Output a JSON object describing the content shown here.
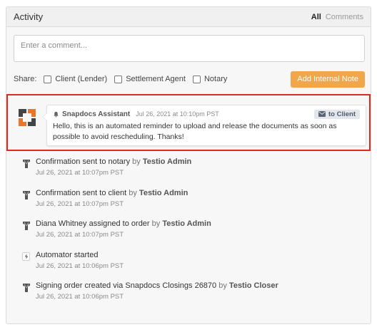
{
  "panel": {
    "title": "Activity",
    "filters": {
      "all": "All",
      "comments": "Comments"
    }
  },
  "comment": {
    "placeholder": "Enter a comment..."
  },
  "share": {
    "label": "Share:",
    "options": [
      "Client (Lender)",
      "Settlement Agent",
      "Notary"
    ],
    "add_note_label": "Add Internal Note"
  },
  "highlighted_message": {
    "author": "Snapdocs Assistant",
    "timestamp": "Jul 26, 2021 at 10:10pm PST",
    "badge": "to Client",
    "text": "Hello, this is an automated reminder to upload and release the documents as soon as possible to avoid rescheduling. Thanks!"
  },
  "feed": [
    {
      "text": "Confirmation sent to notary",
      "by": "by",
      "actor": "Testio Admin",
      "time": "Jul 26, 2021 at 10:07pm PST",
      "icon": "user-icon"
    },
    {
      "text": "Confirmation sent to client",
      "by": "by",
      "actor": "Testio Admin",
      "time": "Jul 26, 2021 at 10:07pm PST",
      "icon": "user-icon"
    },
    {
      "text": "Diana Whitney assigned to order",
      "by": "by",
      "actor": "Testio Admin",
      "time": "Jul 26, 2021 at 10:07pm PST",
      "icon": "user-icon"
    },
    {
      "text": "Automator started",
      "by": "",
      "actor": "",
      "time": "Jul 26, 2021 at 10:06pm PST",
      "icon": "bolt-icon"
    },
    {
      "text": "Signing order created via Snapdocs Closings 26870",
      "by": "by",
      "actor": "Testio Closer",
      "time": "Jul 26, 2021 at 10:06pm PST",
      "icon": "user-icon"
    }
  ],
  "colors": {
    "accent_button": "#f0a64a",
    "highlight_border": "#e0281e",
    "logo_orange": "#e8762d",
    "logo_dark": "#444444"
  }
}
